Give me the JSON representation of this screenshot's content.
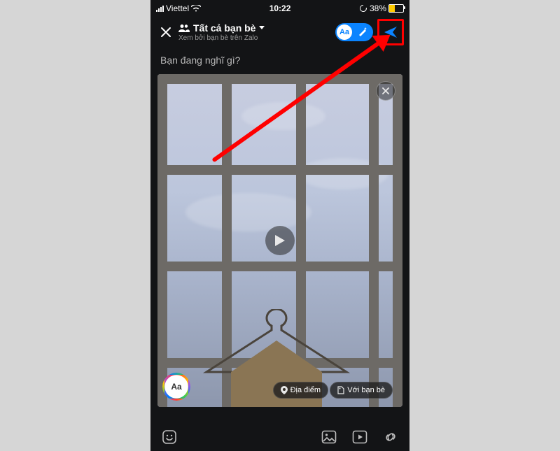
{
  "status": {
    "carrier": "Viettel",
    "time": "10:22",
    "battery_pct": "38%"
  },
  "header": {
    "audience_title": "Tất cả bạn bè",
    "audience_subtitle": "Xem bởi bạn bè trên Zalo",
    "toggle_label": "Aa"
  },
  "compose": {
    "placeholder": "Bạn đang nghĩ gì?"
  },
  "media": {
    "style_label": "Aa",
    "location_chip": "Địa điểm",
    "tag_chip": "Với bạn bè"
  }
}
